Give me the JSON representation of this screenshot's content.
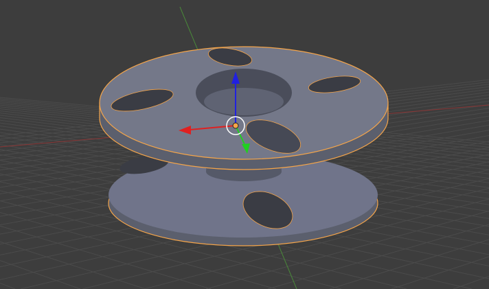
{
  "viewport": {
    "mode": "3d-viewport",
    "object": "spool",
    "selected": true
  },
  "colors": {
    "background": "#3d3d3d",
    "grid": "#4b4b4b",
    "x_axis": "#8a3535",
    "y_axis": "#4a8a3a",
    "mesh": "#6f7383",
    "mesh_side": "#5b5f6d",
    "hole": "#3a3c44",
    "selection_outline": "#f5a54a",
    "gizmo_x": "#e02020",
    "gizmo_y": "#20d020",
    "gizmo_z": "#2020e0"
  },
  "icons": [
    "transform-gizmo-icon",
    "object-origin-icon"
  ]
}
